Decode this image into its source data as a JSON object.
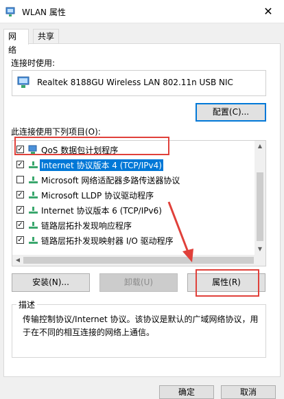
{
  "window": {
    "title": "WLAN 属性",
    "close_icon": "close-icon"
  },
  "tabs": [
    {
      "label": "网络",
      "active": true
    },
    {
      "label": "共享",
      "active": false
    }
  ],
  "connect_using": {
    "label": "连接时使用:",
    "adapter_name": "Realtek 8188GU Wireless LAN 802.11n USB NIC",
    "configure_button": "配置(C)..."
  },
  "items_label": "此连接使用下列项目(O):",
  "items": [
    {
      "label": "QoS 数据包计划程序",
      "checked": true,
      "icon": "qos-network-icon"
    },
    {
      "label": "Internet 协议版本 4 (TCP/IPv4)",
      "checked": true,
      "icon": "protocol-icon",
      "selected": true
    },
    {
      "label": "Microsoft 网络适配器多路传送器协议",
      "checked": false,
      "icon": "protocol-icon"
    },
    {
      "label": "Microsoft LLDP 协议驱动程序",
      "checked": true,
      "icon": "protocol-icon"
    },
    {
      "label": "Internet 协议版本 6 (TCP/IPv6)",
      "checked": true,
      "icon": "protocol-icon"
    },
    {
      "label": "链路层拓扑发现响应程序",
      "checked": true,
      "icon": "protocol-icon"
    },
    {
      "label": "链路层拓扑发现映射器 I/O 驱动程序",
      "checked": true,
      "icon": "protocol-icon"
    }
  ],
  "buttons": {
    "install": "安装(N)...",
    "uninstall": "卸载(U)",
    "properties": "属性(R)"
  },
  "description": {
    "group_label": "描述",
    "text": "传输控制协议/Internet 协议。该协议是默认的广域网络协议，用于在不同的相互连接的网络上通信。"
  },
  "bottom_buttons": {
    "ok": "确定",
    "cancel": "取消"
  },
  "colors": {
    "accent": "#0078d7",
    "annotation_red": "#e0403a",
    "icon_green": "#3aa76d"
  }
}
